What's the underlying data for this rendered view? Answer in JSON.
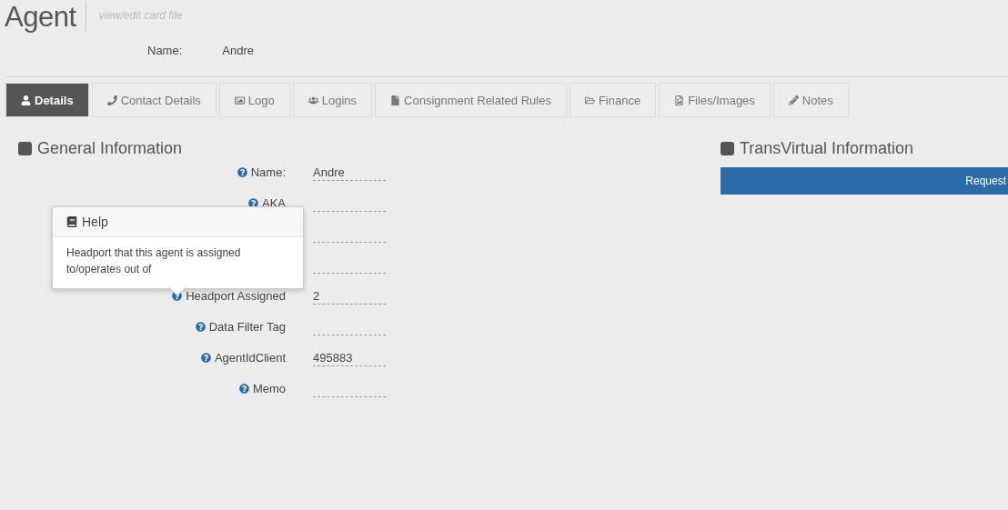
{
  "header": {
    "title": "Agent",
    "subtitle": "view/edit card file"
  },
  "summary": {
    "label": "Name:",
    "value": "Andre"
  },
  "tabs": [
    {
      "kind": "user",
      "label": "Details",
      "selected": true
    },
    {
      "kind": "phone",
      "label": "Contact Details",
      "selected": false
    },
    {
      "kind": "image",
      "label": "Logo",
      "selected": false
    },
    {
      "kind": "users",
      "label": "Logins",
      "selected": false
    },
    {
      "kind": "file",
      "label": "Consignment Related Rules",
      "selected": false
    },
    {
      "kind": "folder",
      "label": "Finance",
      "selected": false
    },
    {
      "kind": "file-image",
      "label": "Files/Images",
      "selected": false
    },
    {
      "kind": "pencil",
      "label": "Notes",
      "selected": false
    }
  ],
  "general": {
    "title": "General Information",
    "fields": [
      {
        "kind": "text",
        "label": "Name:",
        "value": "Andre"
      },
      {
        "kind": "text",
        "label": "AKA"
      },
      {
        "kind": "text"
      },
      {
        "kind": "text"
      },
      {
        "kind": "text",
        "label": "Headport Assigned",
        "value": "2"
      },
      {
        "kind": "text",
        "label": "Data Filter Tag"
      },
      {
        "kind": "text",
        "label": "AgentIdClient",
        "value": "495883"
      },
      {
        "kind": "text",
        "label": "Memo"
      }
    ]
  },
  "help_popover": {
    "title": "Help",
    "text": "Headport that this agent is assigned to/operates out of"
  },
  "transvirtual": {
    "title": "TransVirtual Information",
    "button": "Request"
  }
}
